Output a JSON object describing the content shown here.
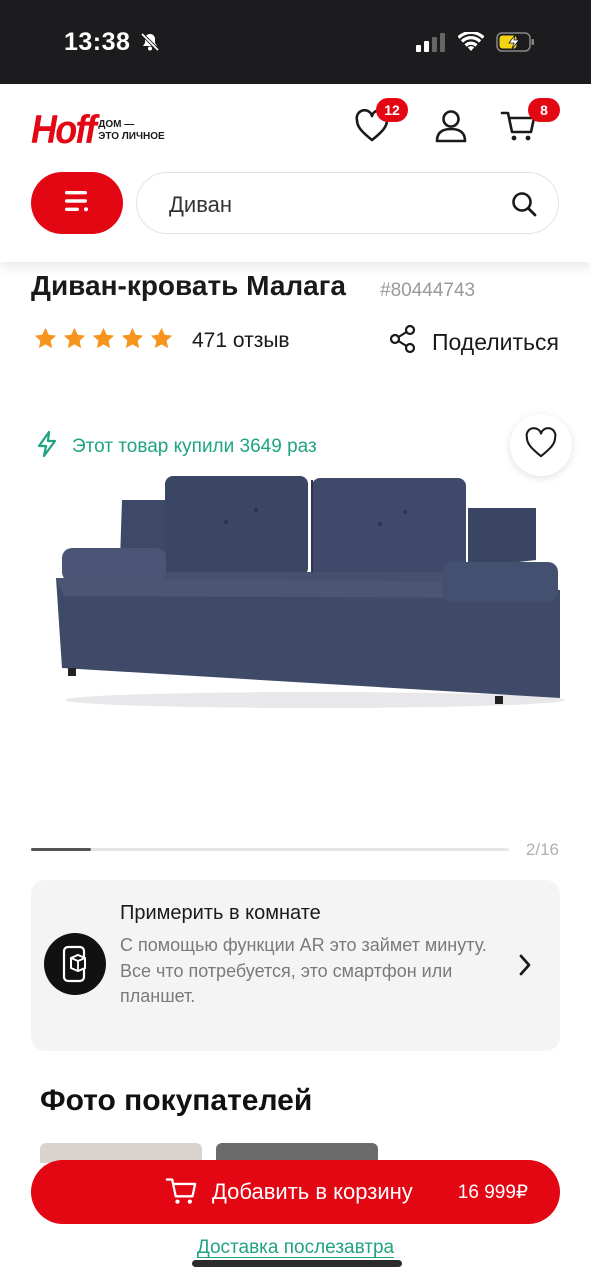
{
  "status_bar": {
    "time": "13:38",
    "icons": [
      "bell-slash-icon",
      "signal-icon",
      "wifi-icon",
      "battery-charging-icon"
    ]
  },
  "header": {
    "logo_text": "Hoff",
    "logo_tagline_line1": "ДОМ —",
    "logo_tagline_line2": "ЭТО ЛИЧНОЕ",
    "favorites_count": "12",
    "cart_count": "8",
    "search_value": "Диван"
  },
  "product": {
    "title": "Диван-кровать Малага",
    "sku": "#80444743",
    "rating": 5,
    "reviews": "471 отзыв",
    "share_label": "Поделиться",
    "bought_text": "Этот товар купили 3649 раз",
    "gallery_counter": "2/16",
    "gallery_progress": 0.125
  },
  "ar": {
    "title": "Примерить в комнате",
    "text": "С помощью функции AR это займет минуту.\nВсе что потребуется, это смартфон или планшет."
  },
  "customer_photos": {
    "title": "Фото покупателей"
  },
  "cart_bar": {
    "label": "Добавить в корзину",
    "price": "16 999₽",
    "delivery": "Доставка послезавтра"
  },
  "colors": {
    "brand_red": "#e30613",
    "accent_green": "#1fa380",
    "star_orange": "#f7941d",
    "sofa_blue": "#3f4a6b"
  }
}
